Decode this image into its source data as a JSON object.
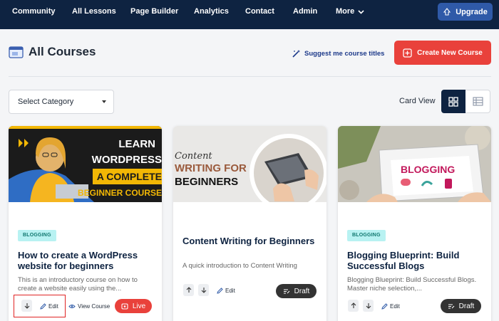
{
  "nav": {
    "items": [
      "Community",
      "All Lessons",
      "Page Builder",
      "Analytics",
      "Contact",
      "Admin"
    ],
    "more_label": "More",
    "upgrade_label": "Upgrade"
  },
  "header": {
    "title": "All Courses",
    "suggest_label": "Suggest me course titles",
    "create_label": "Create New Course"
  },
  "filters": {
    "category_selected": "Select Category",
    "view_label": "Card View"
  },
  "courses": [
    {
      "category": "BLOGGING",
      "title": "How to create a WordPress website for beginners",
      "description": "This is an introductory course on how to create a website easily using the...",
      "edit_label": "Edit",
      "view_label": "View Course",
      "status": "Live",
      "image_text": [
        "LEARN",
        "WORDPRESS",
        "A COMPLETE",
        "BEGINNER COURSE"
      ]
    },
    {
      "category": "",
      "title": "Content Writing for Beginners",
      "description": "A quick introduction to Content Writing",
      "edit_label": "Edit",
      "status": "Draft",
      "image_text": [
        "Content",
        "WRITING FOR",
        "BEGINNERS"
      ]
    },
    {
      "category": "BLOGGING",
      "title": "Blogging Blueprint: Build Successful Blogs",
      "description": "Blogging Blueprint: Build Successful Blogs. Master niche selection,...",
      "edit_label": "Edit",
      "status": "Draft",
      "image_text": [
        "BLOGGING"
      ]
    }
  ],
  "colors": {
    "nav_bg": "#0e2341",
    "primary_red": "#e9413b",
    "upgrade_blue": "#2f5aa8",
    "draft_pill": "#333333",
    "badge_bg": "#b8f2f2"
  },
  "icons": [
    "folder-icon",
    "magic-wand-icon",
    "plus-square-icon",
    "rocket-icon",
    "grid-view-icon",
    "list-view-icon",
    "arrow-up-icon",
    "arrow-down-icon",
    "pencil-icon",
    "eye-icon",
    "chevron-down-icon"
  ]
}
